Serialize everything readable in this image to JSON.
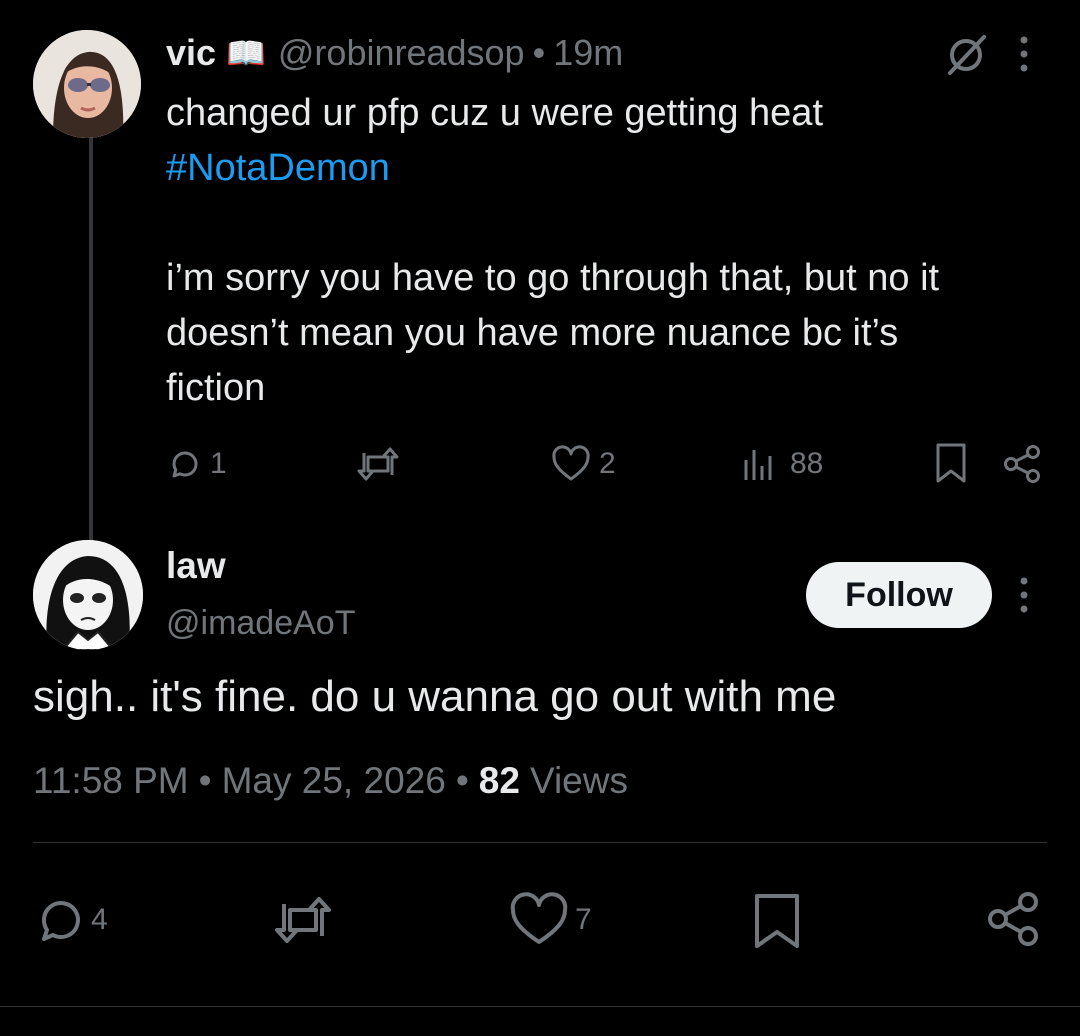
{
  "reply": {
    "author_name": "vic",
    "author_emoji": "📖",
    "handle": "@robinreadsop",
    "separator": "•",
    "time": "19m",
    "text_line1": "changed ur pfp cuz u were getting heat",
    "hashtag": "#NotaDemon",
    "text_line2": "i’m sorry you have to go through that, but no it",
    "text_line3": "doesn’t mean you have more nuance bc it’s",
    "text_line4": "fiction",
    "replies": "1",
    "likes": "2",
    "views": "88"
  },
  "main": {
    "author_name": "law",
    "handle": "@imadeAoT",
    "follow_label": "Follow",
    "text": "sigh.. it's fine. do u wanna go out with me",
    "time": "11:58 PM",
    "sep1": "•",
    "date": "May 25, 2026",
    "sep2": "•",
    "views_count": "82",
    "views_label": "Views",
    "replies": "4",
    "likes": "7"
  },
  "colors": {
    "background": "#000000",
    "text": "#e7e9ea",
    "muted": "#71767b",
    "link": "#1d9bf0",
    "follow_bg": "#eff3f4"
  },
  "icons": [
    "grok-icon",
    "more-icon",
    "reply-icon",
    "retweet-icon",
    "like-icon",
    "views-icon",
    "bookmark-icon",
    "share-icon"
  ]
}
